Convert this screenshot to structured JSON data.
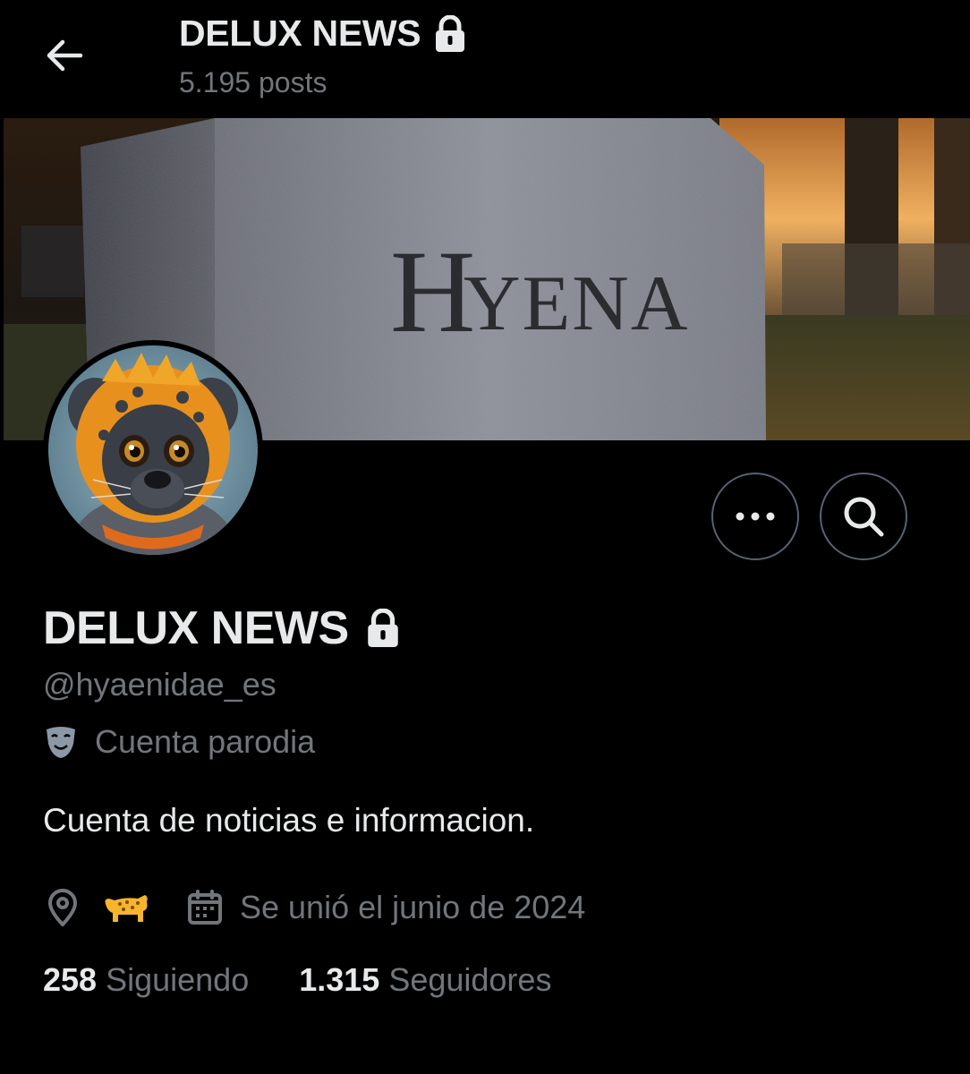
{
  "header": {
    "title": "DELUX NEWS",
    "posts_count": "5.195 posts",
    "back_icon": "arrow-left-icon",
    "lock_icon": "lock-icon"
  },
  "banner": {
    "headstone_text": "HYENA"
  },
  "actions": {
    "more_icon": "more-horizontal-icon",
    "search_icon": "search-icon"
  },
  "profile": {
    "name": "DELUX NEWS",
    "handle": "@hyaenidae_es",
    "parody_label": "Cuenta parodia",
    "bio": "Cuenta de noticias e informacion.",
    "location_emoji": "leopard-emoji",
    "joined": "Se unió el junio de 2024",
    "following_count": "258",
    "following_label": "Siguiendo",
    "followers_count": "1.315",
    "followers_label": "Seguidores"
  },
  "colors": {
    "background": "#000000",
    "text_primary": "#e7e9ea",
    "text_secondary": "#71767b",
    "border": "#536471"
  }
}
